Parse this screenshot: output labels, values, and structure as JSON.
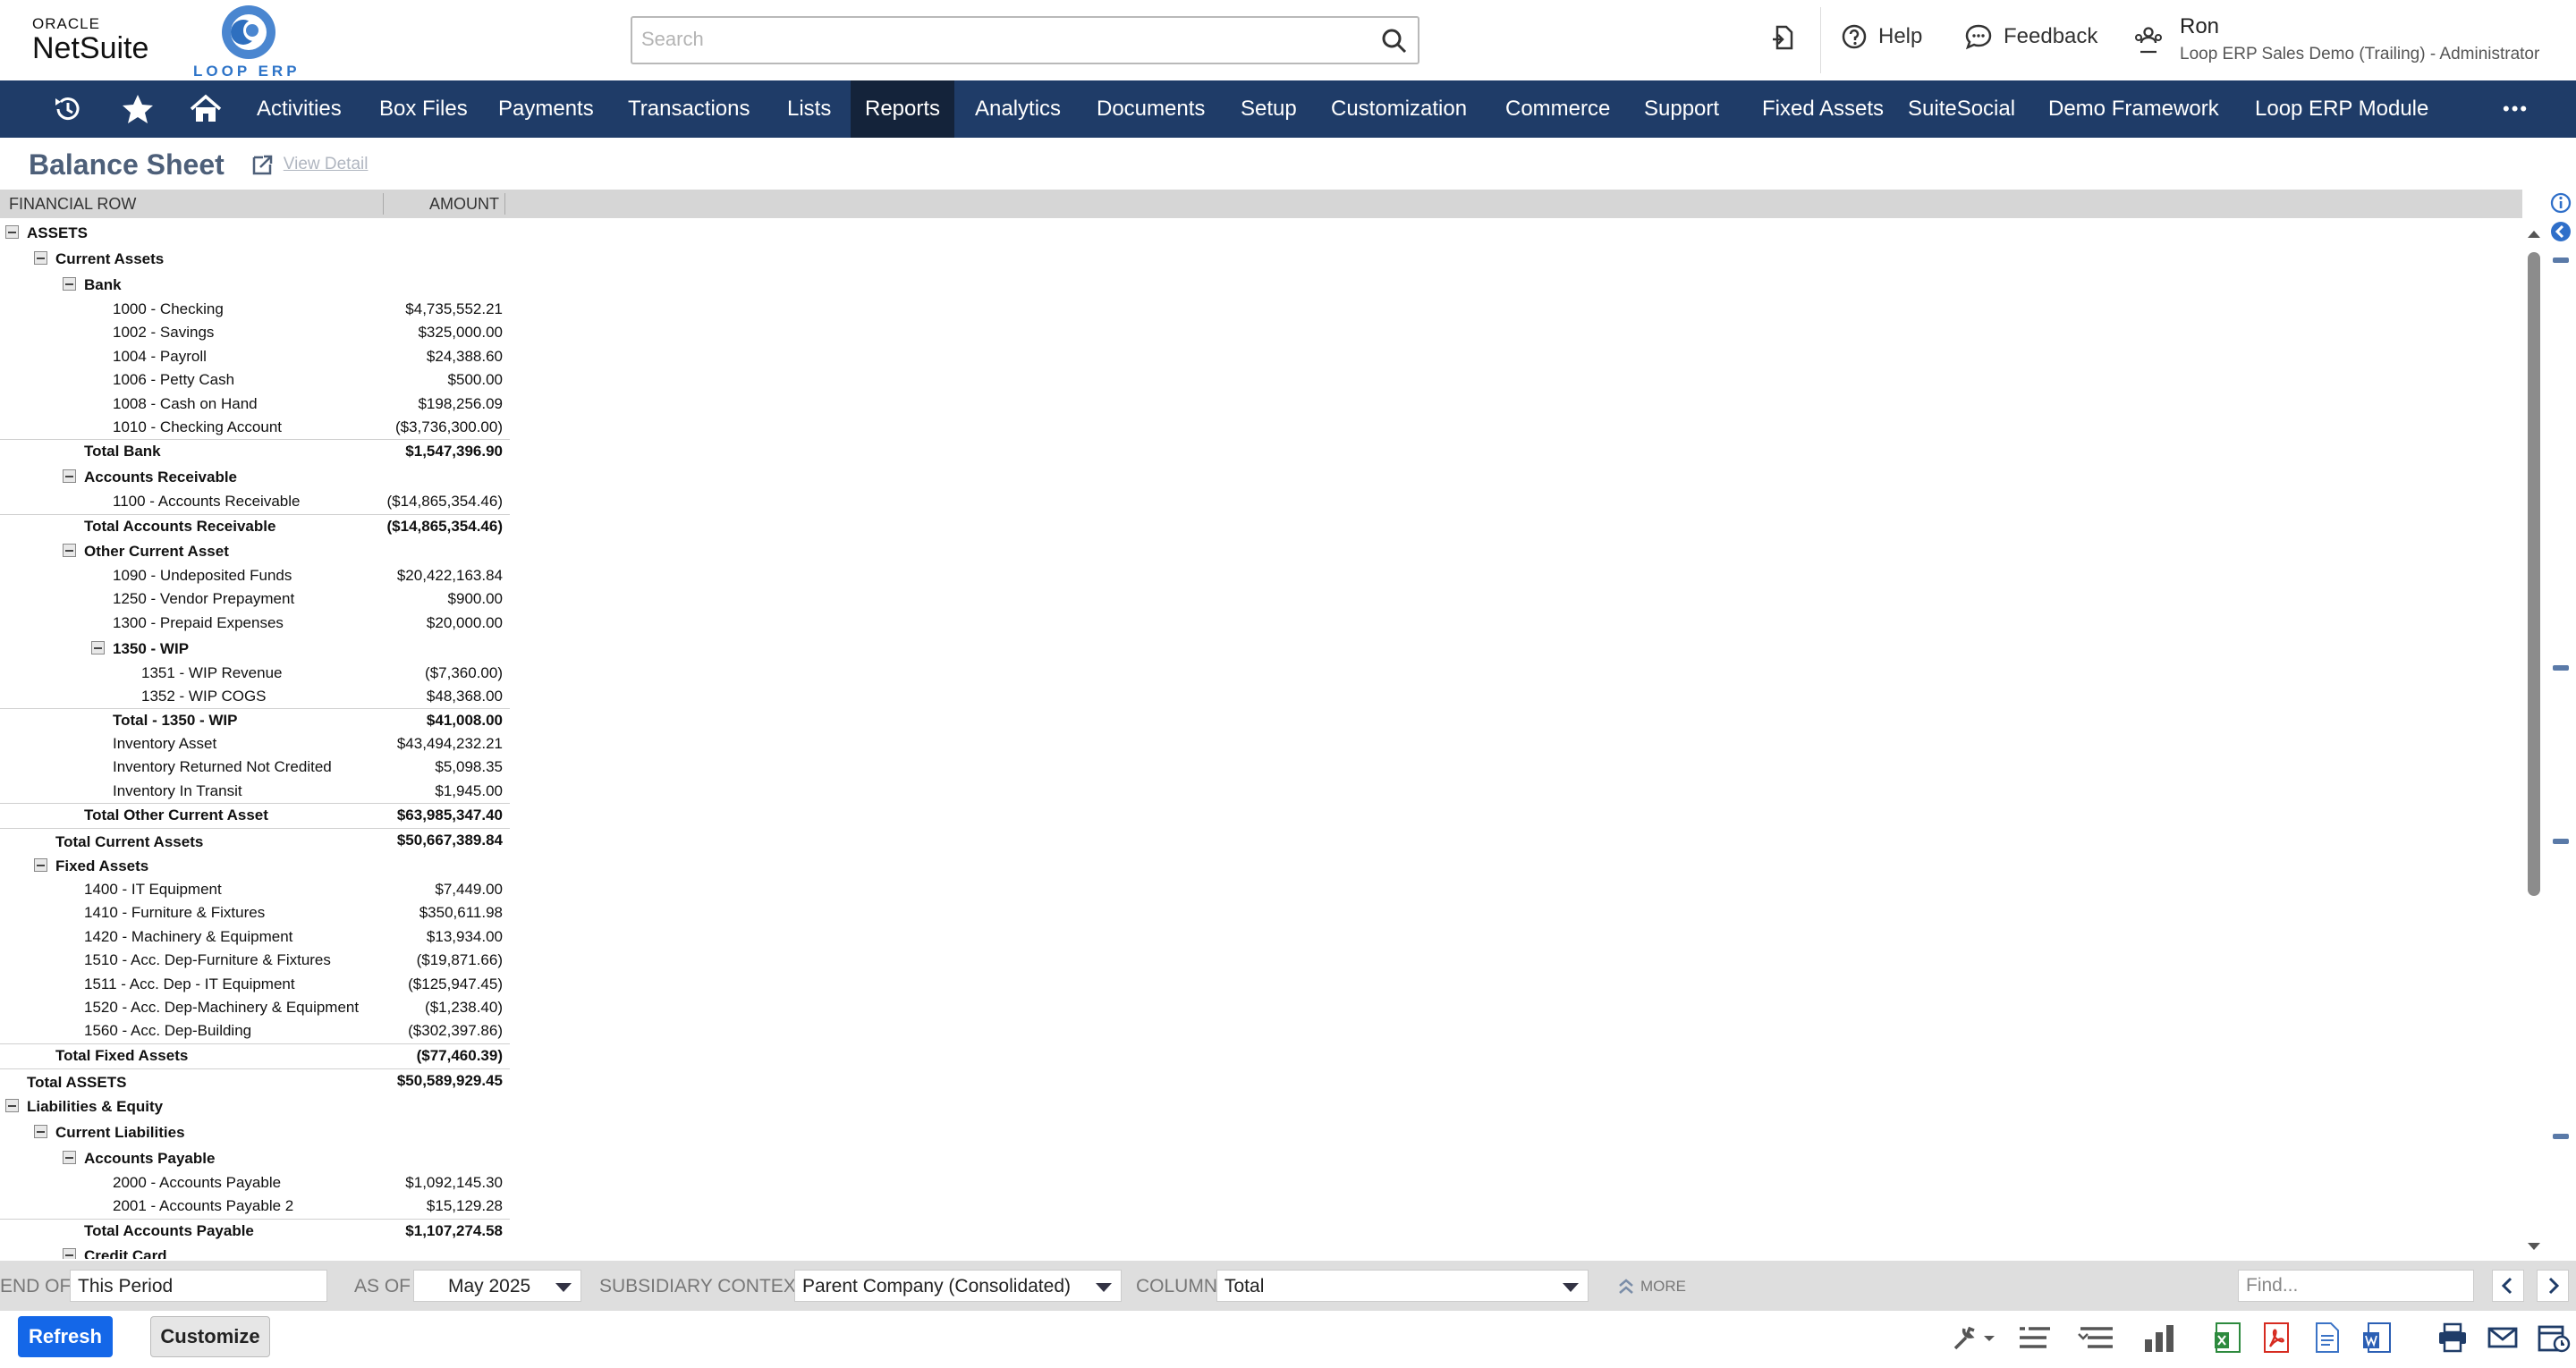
{
  "header": {
    "logo_oracle": "ORACLE",
    "logo_netsuite": "NetSuite",
    "loop_logo_text": "LOOP ERP",
    "search_placeholder": "Search",
    "help_label": "Help",
    "feedback_label": "Feedback",
    "user_name": "Ron",
    "user_role": "Loop ERP Sales Demo (Trailing) - Administrator"
  },
  "nav": {
    "items": [
      "Activities",
      "Box Files",
      "Payments",
      "Transactions",
      "Lists",
      "Reports",
      "Analytics",
      "Documents",
      "Setup",
      "Customization",
      "Commerce",
      "Support",
      "Fixed Assets",
      "SuiteSocial",
      "Demo Framework",
      "Loop ERP Module"
    ],
    "active": "Reports",
    "more_label": "•••"
  },
  "page": {
    "title": "Balance Sheet",
    "view_detail": "View Detail"
  },
  "report": {
    "col_financial_row": "FINANCIAL ROW",
    "col_amount": "AMOUNT",
    "rows": [
      {
        "label": "ASSETS",
        "amount": "",
        "bold": true
      },
      {
        "label": "Current Assets",
        "amount": "",
        "bold": true
      },
      {
        "label": "Bank",
        "amount": "",
        "bold": true
      },
      {
        "label": "1000 - Checking",
        "amount": "$4,735,552.21"
      },
      {
        "label": "1002 - Savings",
        "amount": "$325,000.00"
      },
      {
        "label": "1004 - Payroll",
        "amount": "$24,388.60"
      },
      {
        "label": "1006 - Petty Cash",
        "amount": "$500.00"
      },
      {
        "label": "1008 - Cash on Hand",
        "amount": "$198,256.09"
      },
      {
        "label": "1010 - Checking Account",
        "amount": "($3,736,300.00)"
      },
      {
        "label": "Total Bank",
        "amount": "$1,547,396.90",
        "bold": true
      },
      {
        "label": "Accounts Receivable",
        "amount": "",
        "bold": true
      },
      {
        "label": "1100 - Accounts Receivable",
        "amount": "($14,865,354.46)"
      },
      {
        "label": "Total Accounts Receivable",
        "amount": "($14,865,354.46)",
        "bold": true
      },
      {
        "label": "Other Current Asset",
        "amount": "",
        "bold": true
      },
      {
        "label": "1090 - Undeposited Funds",
        "amount": "$20,422,163.84"
      },
      {
        "label": "1250 - Vendor Prepayment",
        "amount": "$900.00"
      },
      {
        "label": "1300 - Prepaid Expenses",
        "amount": "$20,000.00"
      },
      {
        "label": "1350 - WIP",
        "amount": "",
        "bold": true
      },
      {
        "label": "1351 - WIP Revenue",
        "amount": "($7,360.00)"
      },
      {
        "label": "1352 - WIP COGS",
        "amount": "$48,368.00"
      },
      {
        "label": "Total - 1350 - WIP",
        "amount": "$41,008.00",
        "bold": true
      },
      {
        "label": "Inventory Asset",
        "amount": "$43,494,232.21"
      },
      {
        "label": "Inventory Returned Not Credited",
        "amount": "$5,098.35"
      },
      {
        "label": "Inventory In Transit",
        "amount": "$1,945.00"
      },
      {
        "label": "Total Other Current Asset",
        "amount": "$63,985,347.40",
        "bold": true
      },
      {
        "label": "Total Current Assets",
        "amount": "$50,667,389.84",
        "bold": true
      },
      {
        "label": "Fixed Assets",
        "amount": "",
        "bold": true
      },
      {
        "label": "1400 - IT Equipment",
        "amount": "$7,449.00"
      },
      {
        "label": "1410 - Furniture & Fixtures",
        "amount": "$350,611.98"
      },
      {
        "label": "1420 - Machinery & Equipment",
        "amount": "$13,934.00"
      },
      {
        "label": "1510 - Acc. Dep-Furniture & Fixtures",
        "amount": "($19,871.66)"
      },
      {
        "label": "1511 - Acc. Dep - IT Equipment",
        "amount": "($125,947.45)"
      },
      {
        "label": "1520 - Acc. Dep-Machinery & Equipment",
        "amount": "($1,238.40)"
      },
      {
        "label": "1560 - Acc. Dep-Building",
        "amount": "($302,397.86)"
      },
      {
        "label": "Total Fixed Assets",
        "amount": "($77,460.39)",
        "bold": true
      },
      {
        "label": "Total ASSETS",
        "amount": "$50,589,929.45",
        "bold": true
      },
      {
        "label": "Liabilities & Equity",
        "amount": "",
        "bold": true
      },
      {
        "label": "Current Liabilities",
        "amount": "",
        "bold": true
      },
      {
        "label": "Accounts Payable",
        "amount": "",
        "bold": true
      },
      {
        "label": "2000 - Accounts Payable",
        "amount": "$1,092,145.30"
      },
      {
        "label": "2001 - Accounts Payable 2",
        "amount": "$15,129.28"
      },
      {
        "label": "Total Accounts Payable",
        "amount": "$1,107,274.58",
        "bold": true
      },
      {
        "label": "Credit Card",
        "amount": "",
        "bold": true
      }
    ]
  },
  "filters": {
    "end_of_label": "END OF",
    "end_of_value": "This Period",
    "as_of_label": "AS OF",
    "as_of_value": "May 2025",
    "subsidiary_label": "SUBSIDIARY CONTEXT",
    "subsidiary_value": "Parent Company (Consolidated)",
    "column_label": "COLUMN",
    "column_value": "Total",
    "more_label": "MORE",
    "find_placeholder": "Find..."
  },
  "footer": {
    "refresh_label": "Refresh",
    "customize_label": "Customize"
  },
  "colors": {
    "nav_bg": "#1f3c68",
    "nav_active": "#14233a",
    "title": "#4d5f79",
    "primary_button": "#1467e8"
  }
}
